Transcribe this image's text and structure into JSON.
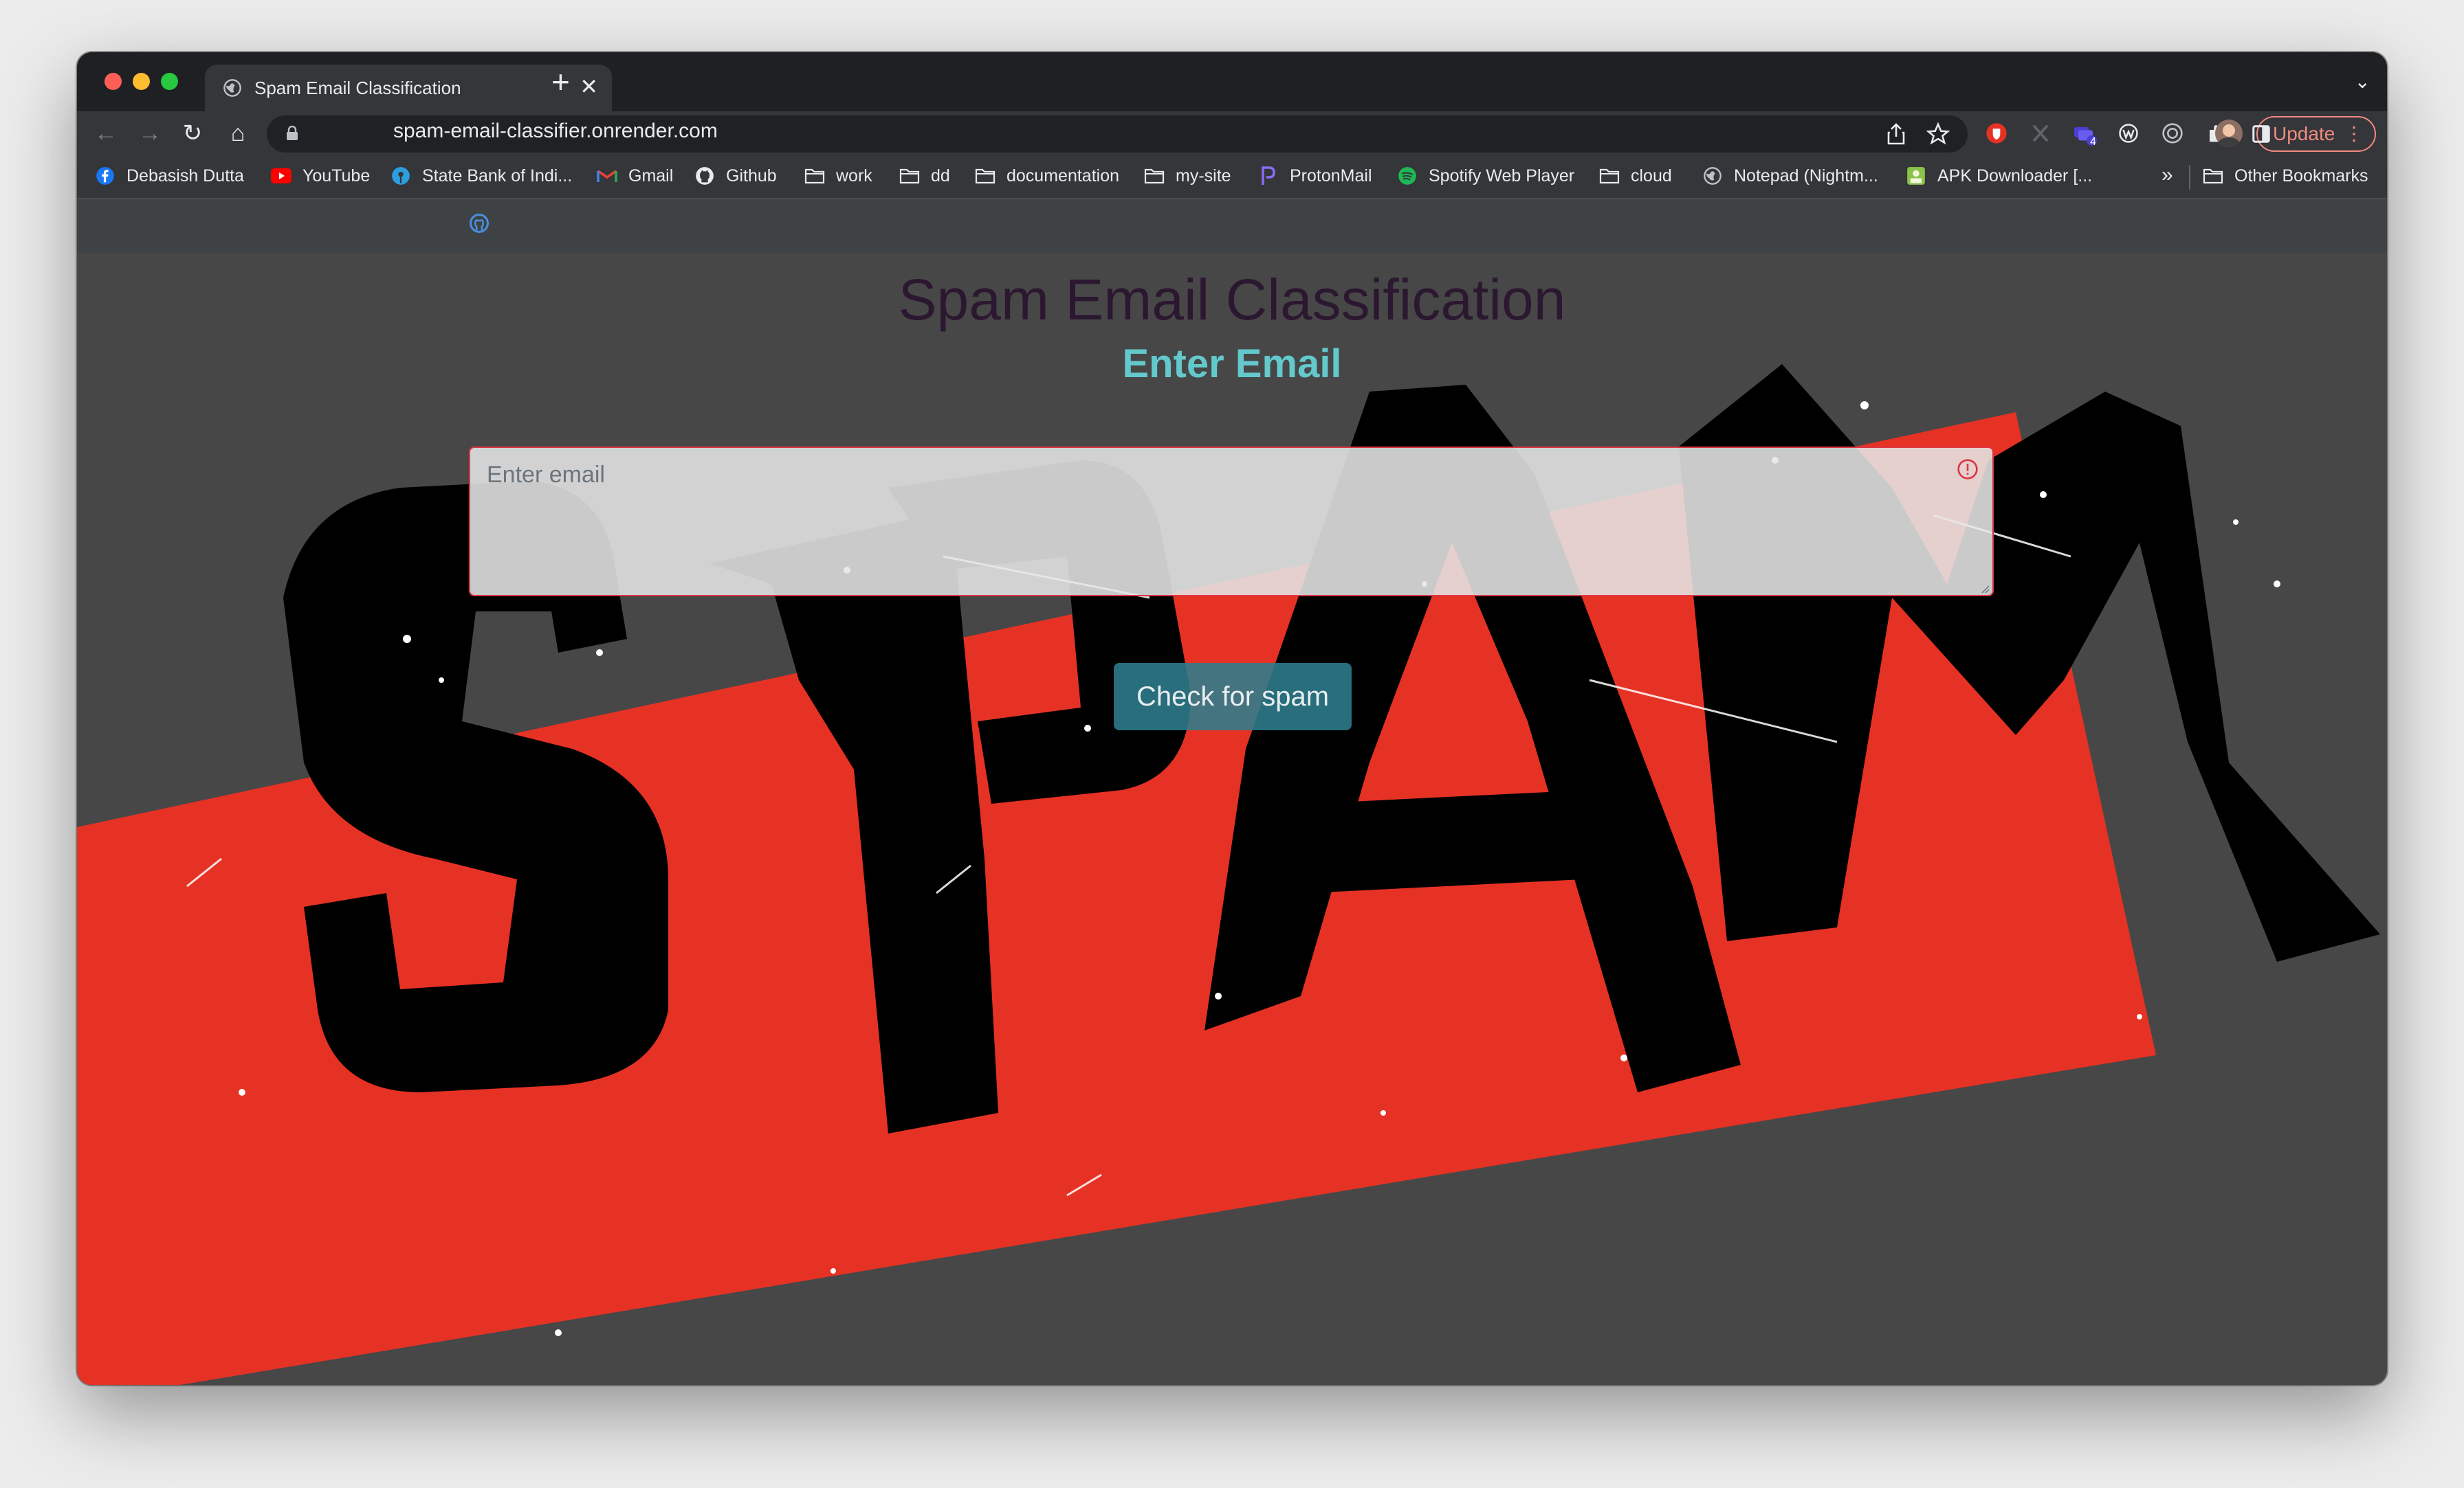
{
  "browser": {
    "tab": {
      "title": "Spam Email Classification",
      "close": "✕",
      "new_tab": "+"
    },
    "tab_search": "⌄",
    "nav": {
      "back": "←",
      "forward": "→",
      "reload": "↻",
      "home": "⌂"
    },
    "url": "spam-email-classifier.onrender.com",
    "omnibox_icons": [
      "lock-icon",
      "share-icon",
      "star-icon"
    ],
    "extensions": [
      "shield-extension-icon",
      "x-extension-icon",
      "tabs-extension-icon",
      "w-extension-icon",
      "target-extension-icon",
      "puzzle-icon",
      "sidepanel-icon",
      "profile-avatar"
    ],
    "extension_badge": "4",
    "update_label": "Update",
    "update_menu": "⋮",
    "bookmarks": [
      {
        "label": "Debasish Dutta",
        "icon": "facebook-icon"
      },
      {
        "label": "YouTube",
        "icon": "youtube-icon"
      },
      {
        "label": "State Bank of Indi...",
        "icon": "sbi-icon"
      },
      {
        "label": "Gmail",
        "icon": "gmail-icon"
      },
      {
        "label": "Github",
        "icon": "github-icon"
      },
      {
        "label": "work",
        "icon": "folder-icon"
      },
      {
        "label": "dd",
        "icon": "folder-icon"
      },
      {
        "label": "documentation",
        "icon": "folder-icon"
      },
      {
        "label": "my-site",
        "icon": "folder-icon"
      },
      {
        "label": "ProtonMail",
        "icon": "protonmail-icon"
      },
      {
        "label": "Spotify Web Player",
        "icon": "spotify-icon"
      },
      {
        "label": "cloud",
        "icon": "folder-icon"
      },
      {
        "label": "Notepad (Nightm...",
        "icon": "globe-icon"
      },
      {
        "label": "APK Downloader [...",
        "icon": "apk-icon"
      }
    ],
    "bookmarks_overflow": "»",
    "other_bookmarks": "Other Bookmarks"
  },
  "page": {
    "nav_icon": "github-icon",
    "title": "Spam Email Classification",
    "subtitle": "Enter Email",
    "email_placeholder": "Enter email",
    "email_value": "",
    "validation_icon": "exclamation-circle-icon",
    "submit_label": "Check for spam",
    "background_art": "SPAM stamp",
    "colors": {
      "page_bg": "#474747",
      "stamp_red": "#e53224",
      "subtitle": "#63c9cc",
      "button": "#2e7d8d",
      "invalid_border": "#dc3545"
    }
  }
}
